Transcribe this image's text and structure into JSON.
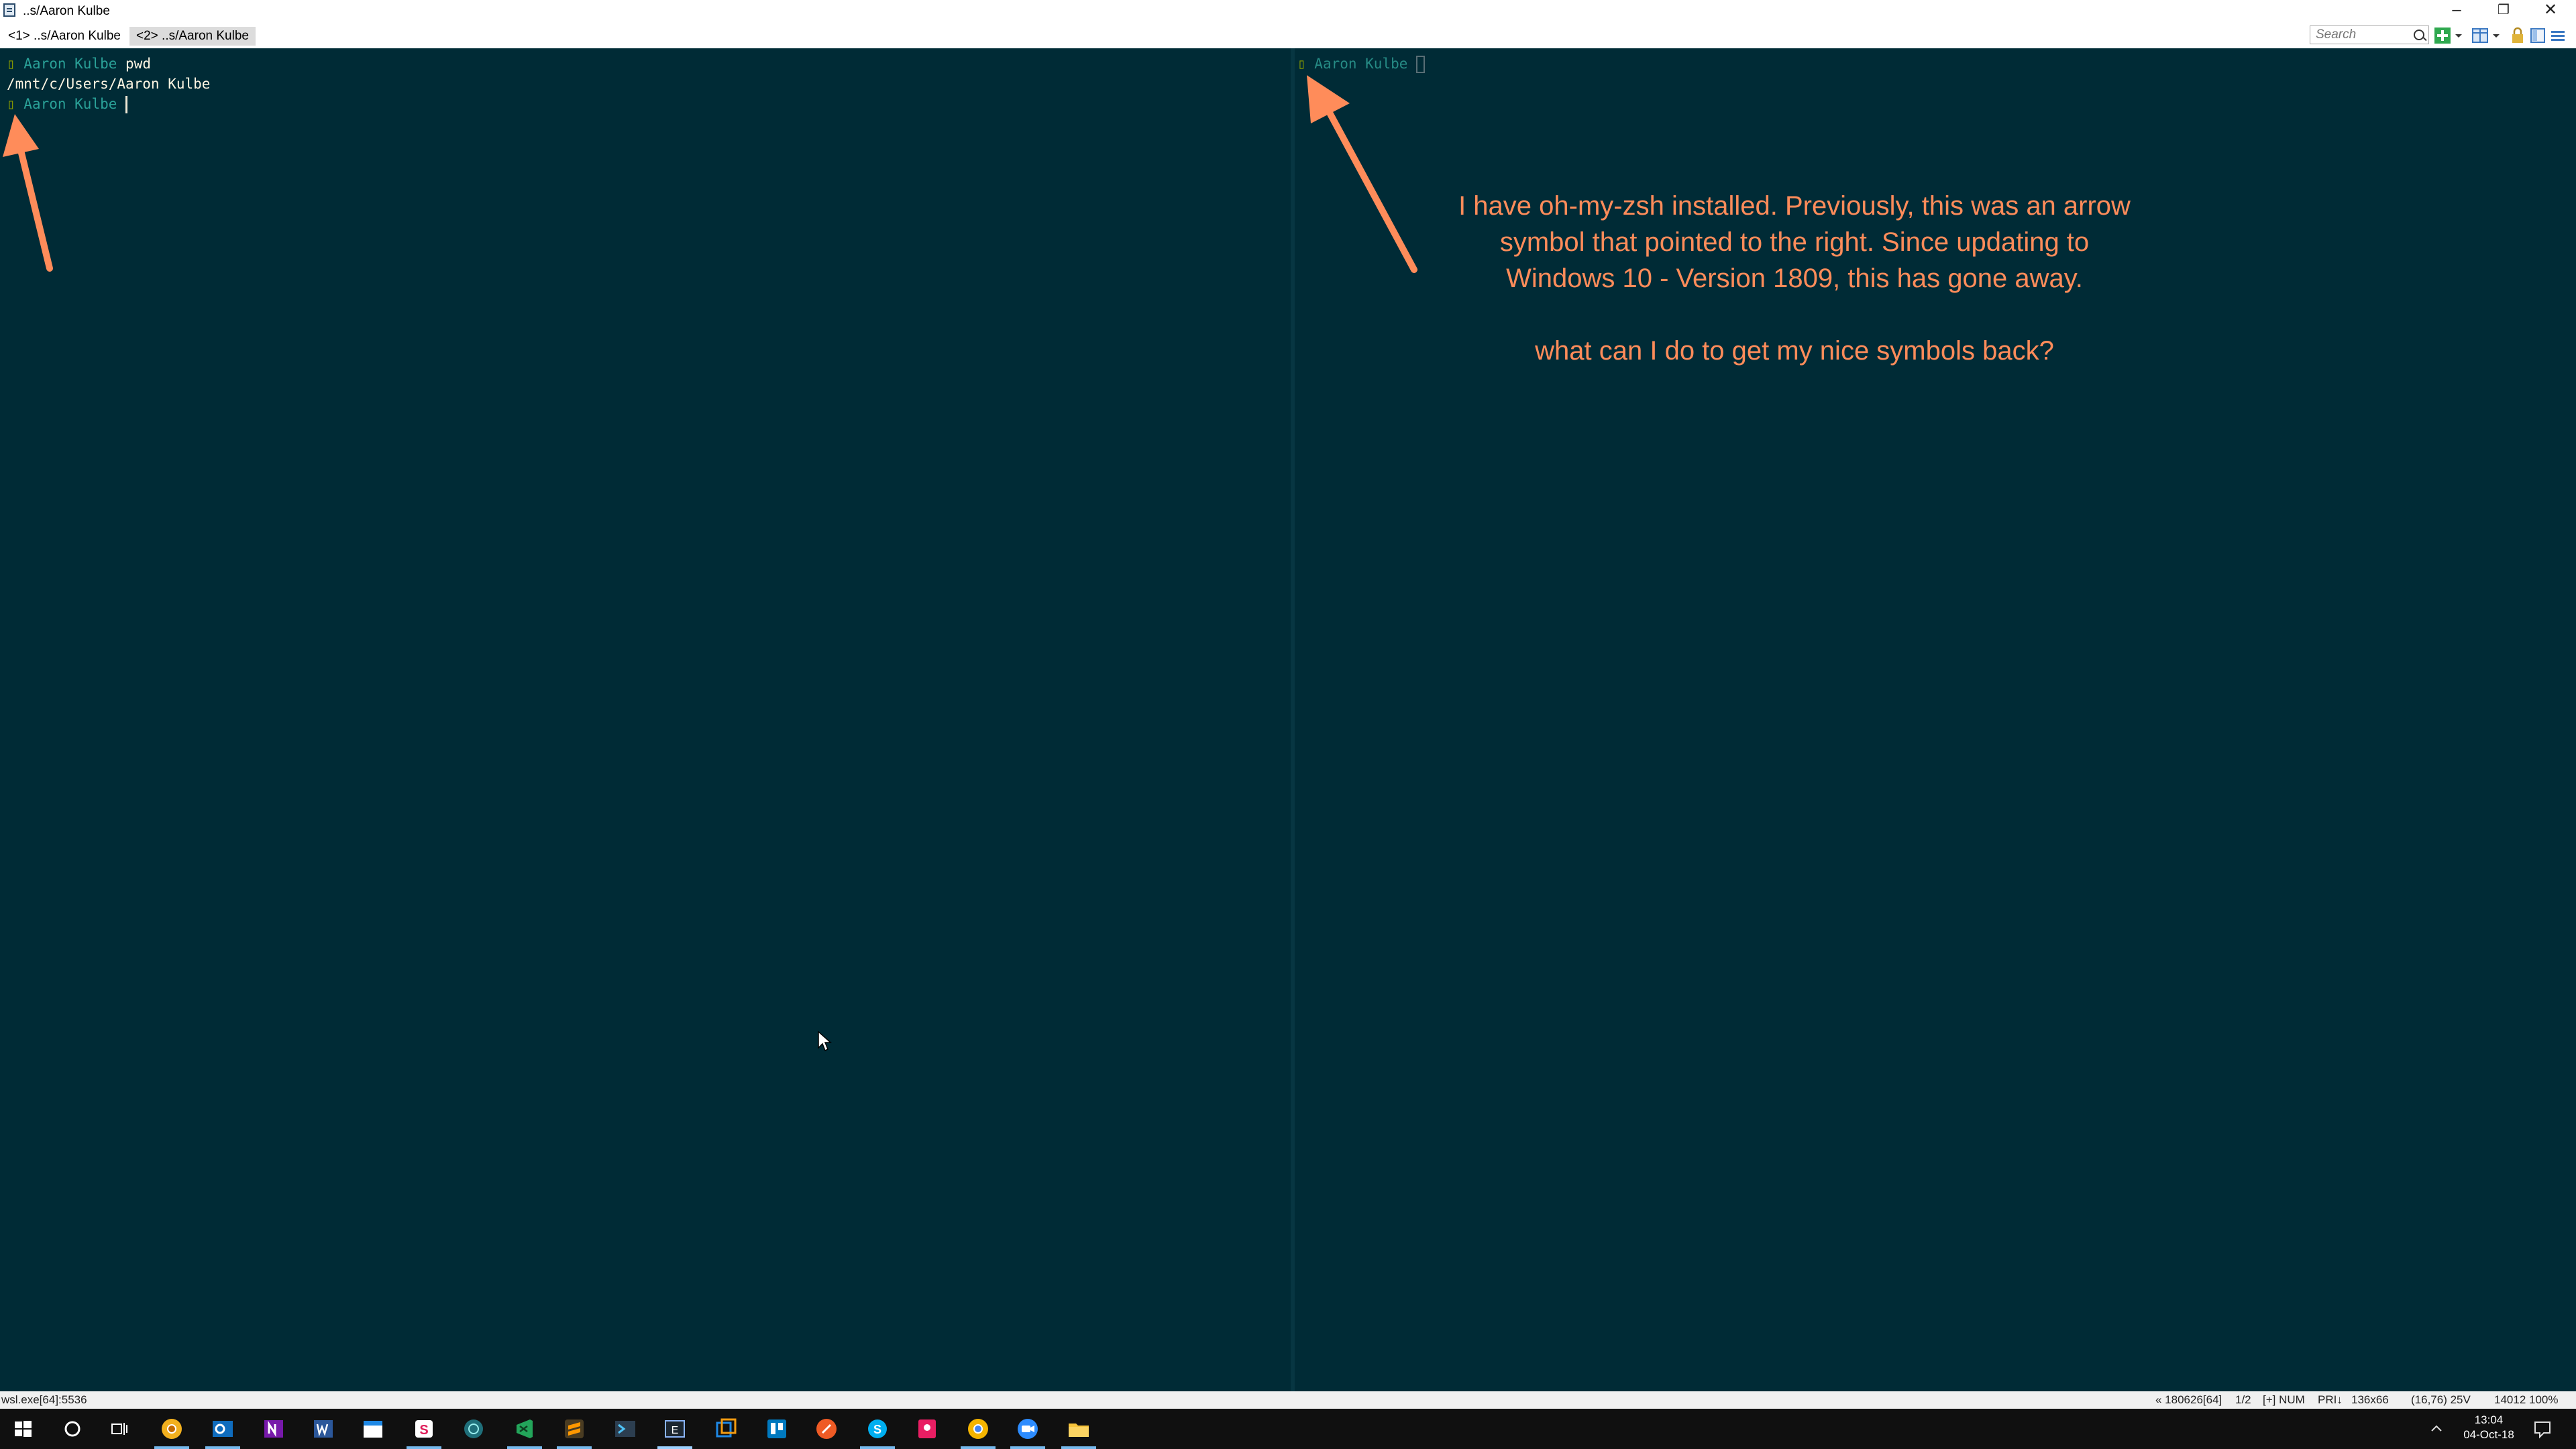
{
  "window": {
    "title": "..s/Aaron Kulbe",
    "minimize": "–",
    "restore": "❐",
    "close": "✕"
  },
  "tabs": [
    {
      "label": "<1> ..s/Aaron Kulbe"
    },
    {
      "label": "<2> ..s/Aaron Kulbe"
    }
  ],
  "toolbar": {
    "search_placeholder": "Search"
  },
  "left_pane": {
    "line1": {
      "glyph": "▯",
      "dir": " Aaron Kulbe ",
      "cmd": "pwd"
    },
    "line2": {
      "output": "/mnt/c/Users/Aaron Kulbe"
    },
    "line3": {
      "glyph": "▯",
      "dir": " Aaron Kulbe "
    }
  },
  "right_pane": {
    "line1": {
      "glyph": "▯",
      "dir": " Aaron Kulbe "
    }
  },
  "annotation": {
    "line1": "I have oh-my-zsh installed. Previously, this was an arrow",
    "line2": "symbol that pointed to the right. Since updating to",
    "line3": "Windows 10 - Version 1809, this has gone away.",
    "line4": "what can I do to get my nice symbols back?",
    "arrow_color": "#ff8c5a"
  },
  "statusbar": {
    "process": "wsl.exe[64]:5536",
    "buffer": "« 180626[64]",
    "pane": "1/2",
    "flags": "[+] NUM",
    "priority": "PRI↓",
    "size": "136x66",
    "cursor": "(16,76) 25V",
    "pid_zoom": "14012 100%"
  },
  "taskbar": {
    "icons": [
      "windows-start-icon",
      "cortana-search-icon",
      "task-view-icon",
      "chrome-canary-icon",
      "outlook-icon",
      "onenote-icon",
      "word-icon",
      "calendar-icon",
      "slack-icon",
      "gitkraken-icon",
      "visual-studio-code-icon",
      "sublime-text-icon",
      "terminal-icon",
      "conemu-icon",
      "virtual-desktop-icon",
      "trello-icon",
      "postman-icon",
      "skype-icon",
      "pink-app-icon",
      "chrome-icon",
      "zoom-icon",
      "file-explorer-icon"
    ],
    "time": "13:04",
    "date": "04-Oct-18"
  },
  "colors": {
    "background": "#002b36",
    "prompt_glyph": "#859900",
    "prompt_dir": "#2aa198",
    "annotation": "#ff8c5a"
  }
}
